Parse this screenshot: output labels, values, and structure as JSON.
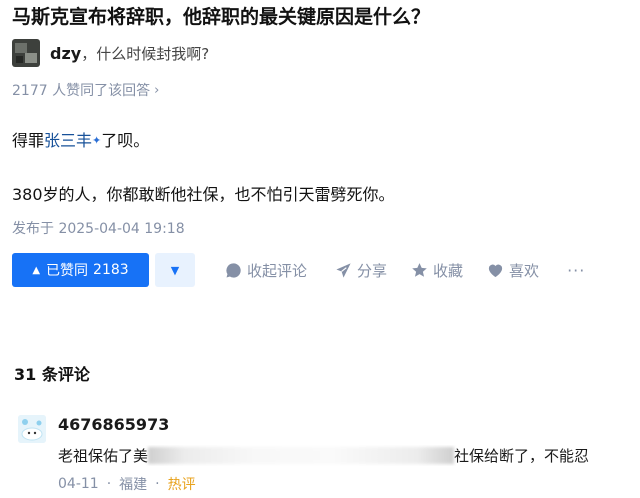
{
  "question": {
    "title": "马斯克宣布将辞职，他辞职的最关键原因是什么？"
  },
  "author": {
    "name": "dzy",
    "separator": "，",
    "bio": "什么时候封我啊?"
  },
  "votes_summary": {
    "text": "2177 人赞同了该回答",
    "chevron": "›"
  },
  "answer": {
    "p1_before": "得罪",
    "p1_mention": "张三丰",
    "p1_mark": "✦",
    "p1_after": "了呗。",
    "p2": "380岁的人，你都敢断他社保，也不怕引天雷劈死你。",
    "published": "发布于 2025-04-04 19:18"
  },
  "actions": {
    "upvote_icon": "▲",
    "upvote_label": "已赞同",
    "upvote_count": "2183",
    "downvote_icon": "▼",
    "collapse_comments": "收起评论",
    "share": "分享",
    "favorite": "收藏",
    "like": "喜欢",
    "more": "···"
  },
  "comments": {
    "title": "31 条评论",
    "items": [
      {
        "user": "4676865973",
        "text_before": "老祖保佑了美",
        "text_after": "社保给断了，不能忍",
        "date": "04-11",
        "location": "福建",
        "dot": "·",
        "tag": "热评"
      }
    ]
  },
  "colors": {
    "accent": "#1772f6",
    "muted": "#8590a6",
    "mention": "#175199",
    "hot": "#e8a21c"
  }
}
